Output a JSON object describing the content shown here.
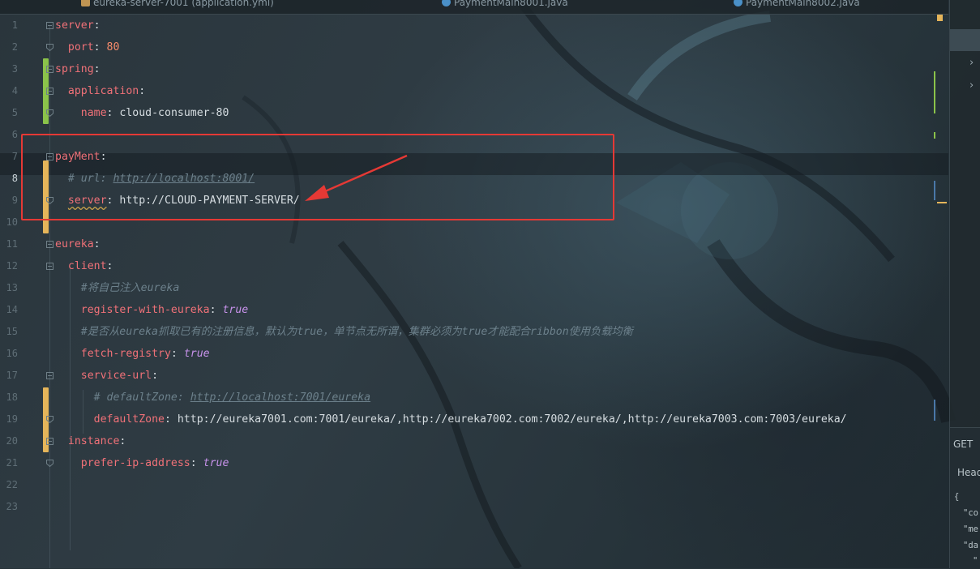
{
  "tabs": [
    {
      "label": "eureka-server-7001 (application.yml)",
      "icon": "yaml-file-icon",
      "color": "#c09553"
    },
    {
      "label": "PaymentMain8001.java",
      "icon": "java-class-icon",
      "color": "#4a90c8"
    },
    {
      "label": "PaymentMain8002.java",
      "icon": "java-class-icon",
      "color": "#4a90c8"
    }
  ],
  "editor": {
    "line_numbers": [
      "1",
      "2",
      "3",
      "4",
      "5",
      "6",
      "7",
      "8",
      "9",
      "10",
      "11",
      "12",
      "13",
      "14",
      "15",
      "16",
      "17",
      "18",
      "19",
      "20",
      "21",
      "22",
      "23"
    ],
    "current_line": "8",
    "lines": {
      "l1_key": "server",
      "l2_key": "port",
      "l2_val": "80",
      "l3_key": "spring",
      "l4_key": "application",
      "l5_key": "name",
      "l5_val": "cloud-consumer-80",
      "l7_key": "payMent",
      "l8_comment": "# url: ",
      "l8_link": "http://localhost:8001/",
      "l9_key": "server",
      "l9_val": "http://CLOUD-PAYMENT-SERVER/",
      "l11_key": "eureka",
      "l12_key": "client",
      "l13_comment": "#将自己注入eureka",
      "l14_key": "register-with-eureka",
      "l14_val": "true",
      "l15_comment": "#是否从eureka抓取已有的注册信息，默认为true，单节点无所谓，集群必须为true才能配合ribbon使用负载均衡",
      "l16_key": "fetch-registry",
      "l16_val": "true",
      "l17_key": "service-url",
      "l18_comment": "# defaultZone: ",
      "l18_link": "http://localhost:7001/eureka",
      "l19_key": "defaultZone",
      "l19_val": "http://eureka7001.com:7001/eureka/,http://eureka7002.com:7002/eureka/,http://eureka7003.com:7003/eureka/",
      "l20_key": "instance",
      "l21_key": "prefer-ip-address",
      "l21_val": "true"
    }
  },
  "right_panel": {
    "method": "GET",
    "headers_tab": "Head",
    "json_lines": [
      "{",
      "\"co",
      "\"me",
      "\"da",
      "\""
    ]
  },
  "colors": {
    "key": "#f07178",
    "number": "#f78c6c",
    "boolean": "#c792ea",
    "comment": "#6c808b",
    "annotation_red": "#e53935",
    "vcs_added": "#8bc34a",
    "vcs_modified": "#e5b55a"
  }
}
